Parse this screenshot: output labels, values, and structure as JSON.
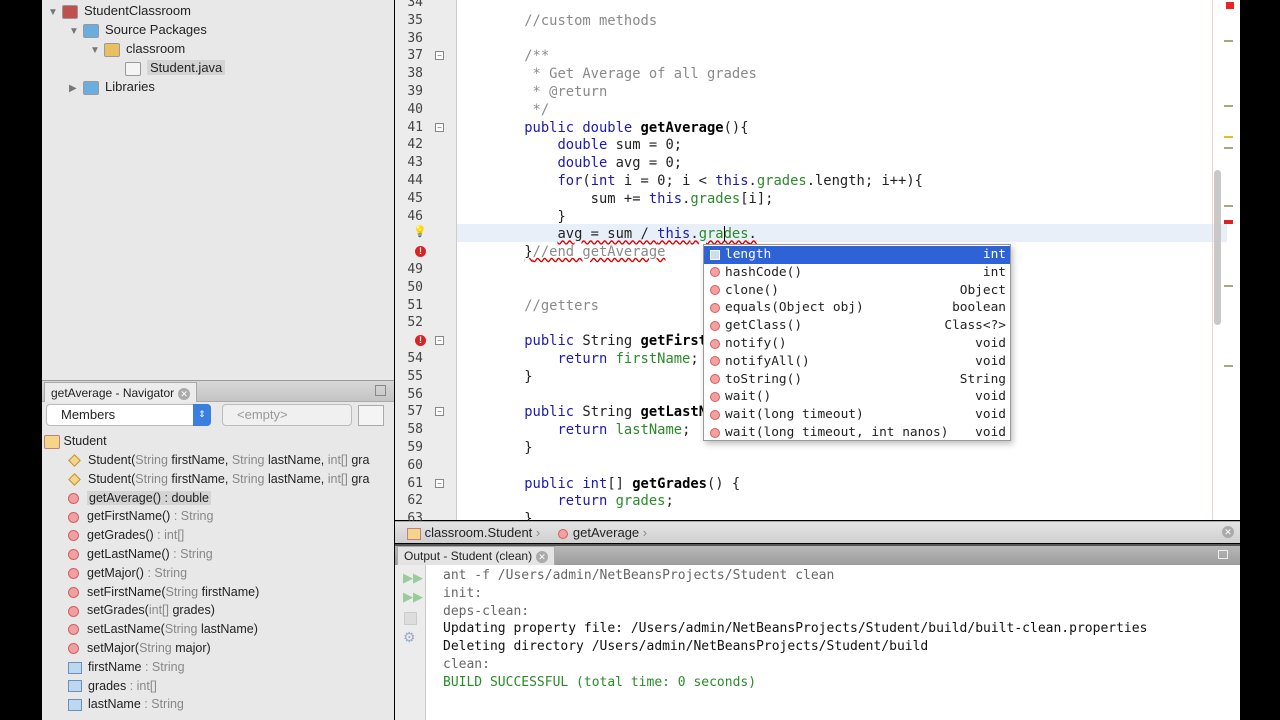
{
  "project": {
    "items": [
      {
        "label": "StudentClassroom",
        "level": 0,
        "expanded": true,
        "icon": "project-icon"
      },
      {
        "label": "Source Packages",
        "level": 1,
        "expanded": true,
        "icon": "source-folder-icon"
      },
      {
        "label": "classroom",
        "level": 2,
        "expanded": true,
        "icon": "package-icon"
      },
      {
        "label": "Student.java",
        "level": 3,
        "selected": true,
        "icon": "java-file-icon"
      },
      {
        "label": "Libraries",
        "level": 1,
        "expanded": false,
        "icon": "libraries-icon"
      }
    ]
  },
  "navigator": {
    "title": "getAverage - Navigator",
    "filter": "Members",
    "filter2": "<empty>",
    "class_name": "Student",
    "members": [
      {
        "kind": "ctor",
        "name": "Student(",
        "sig": [
          [
            "String ",
            "g"
          ],
          [
            "firstName, ",
            ""
          ],
          [
            "String ",
            "g"
          ],
          [
            "lastName, ",
            ""
          ],
          [
            "int[] ",
            "g"
          ],
          [
            "gra",
            ""
          ]
        ]
      },
      {
        "kind": "ctor",
        "name": "Student(",
        "sig": [
          [
            "String ",
            "g"
          ],
          [
            "firstName, ",
            ""
          ],
          [
            "String ",
            "g"
          ],
          [
            "lastName, ",
            ""
          ],
          [
            "int[] ",
            "g"
          ],
          [
            "gra",
            ""
          ]
        ]
      },
      {
        "kind": "method",
        "name": "getAverage() : double",
        "sig": [],
        "selected": true
      },
      {
        "kind": "method",
        "name": "getFirstName()",
        "sig": [
          [
            " : String",
            "g"
          ]
        ]
      },
      {
        "kind": "method",
        "name": "getGrades()",
        "sig": [
          [
            " : int[]",
            "g"
          ]
        ]
      },
      {
        "kind": "method",
        "name": "getLastName()",
        "sig": [
          [
            " : String",
            "g"
          ]
        ]
      },
      {
        "kind": "method",
        "name": "getMajor()",
        "sig": [
          [
            " : String",
            "g"
          ]
        ]
      },
      {
        "kind": "method",
        "name": "setFirstName(",
        "sig": [
          [
            "String ",
            "g"
          ],
          [
            "firstName)",
            ""
          ]
        ]
      },
      {
        "kind": "method",
        "name": "setGrades(",
        "sig": [
          [
            "int[] ",
            "g"
          ],
          [
            "grades)",
            ""
          ]
        ]
      },
      {
        "kind": "method",
        "name": "setLastName(",
        "sig": [
          [
            "String ",
            "g"
          ],
          [
            "lastName)",
            ""
          ]
        ]
      },
      {
        "kind": "method",
        "name": "setMajor(",
        "sig": [
          [
            "String ",
            "g"
          ],
          [
            "major)",
            ""
          ]
        ]
      },
      {
        "kind": "field",
        "name": "firstName",
        "sig": [
          [
            " : String",
            "g"
          ]
        ]
      },
      {
        "kind": "field",
        "name": "grades",
        "sig": [
          [
            " : int[]",
            "g"
          ]
        ]
      },
      {
        "kind": "field",
        "name": "lastName",
        "sig": [
          [
            " : String",
            "g"
          ]
        ]
      }
    ]
  },
  "editor": {
    "lines": [
      {
        "n": "34",
        "t": []
      },
      {
        "n": "35",
        "t": [
          [
            "    //custom methods",
            "cm"
          ]
        ]
      },
      {
        "n": "36",
        "t": []
      },
      {
        "n": "37",
        "t": [
          [
            "    /**",
            "cm"
          ]
        ],
        "fold": true
      },
      {
        "n": "38",
        "t": [
          [
            "     * Get Average of all grades",
            "cm"
          ]
        ]
      },
      {
        "n": "39",
        "t": [
          [
            "     * @return",
            "cm"
          ]
        ]
      },
      {
        "n": "40",
        "t": [
          [
            "     */",
            "cm"
          ]
        ]
      },
      {
        "n": "41",
        "t": [
          [
            "    ",
            ""
          ],
          [
            "public double ",
            "kw"
          ],
          [
            "getAverage",
            "fn"
          ],
          [
            "(){",
            ""
          ]
        ],
        "fold": true
      },
      {
        "n": "42",
        "t": [
          [
            "        ",
            ""
          ],
          [
            "double ",
            "kw"
          ],
          [
            "sum = 0;",
            ""
          ]
        ]
      },
      {
        "n": "43",
        "t": [
          [
            "        ",
            ""
          ],
          [
            "double ",
            "kw"
          ],
          [
            "avg = 0;",
            ""
          ]
        ]
      },
      {
        "n": "44",
        "t": [
          [
            "        ",
            ""
          ],
          [
            "for",
            "kw"
          ],
          [
            "(",
            ""
          ],
          [
            "int ",
            "kw"
          ],
          [
            "i = 0; i < ",
            ""
          ],
          [
            "this",
            "kw"
          ],
          [
            ".",
            ""
          ],
          [
            "grades",
            "fd"
          ],
          [
            ".length; i++){",
            ""
          ]
        ]
      },
      {
        "n": "45",
        "t": [
          [
            "            sum += ",
            ""
          ],
          [
            "this",
            "kw"
          ],
          [
            ".",
            ""
          ],
          [
            "grades",
            "fd"
          ],
          [
            "[i];",
            ""
          ]
        ]
      },
      {
        "n": "46",
        "t": [
          [
            "        }",
            ""
          ]
        ]
      },
      {
        "n": "",
        "t": [
          [
            "        ",
            ""
          ],
          [
            "avg = sum / ",
            "err"
          ],
          [
            "this",
            "kw err"
          ],
          [
            ".",
            "err"
          ],
          [
            "grades",
            "fd err"
          ],
          [
            ".",
            "err"
          ]
        ],
        "icon": "hint"
      },
      {
        "n": "",
        "t": [
          [
            "    ",
            ""
          ],
          [
            "}",
            "err"
          ],
          [
            "//end getAverage",
            "cm err"
          ]
        ],
        "icon": "error"
      },
      {
        "n": "49",
        "t": []
      },
      {
        "n": "50",
        "t": []
      },
      {
        "n": "51",
        "t": [
          [
            "    //getters",
            "cm"
          ]
        ]
      },
      {
        "n": "52",
        "t": []
      },
      {
        "n": "",
        "t": [
          [
            "    ",
            ""
          ],
          [
            "public ",
            "kw"
          ],
          [
            "String ",
            ""
          ],
          [
            "getFirstName",
            "fn"
          ],
          [
            "(){",
            ""
          ]
        ],
        "fold": true,
        "icon": "error"
      },
      {
        "n": "54",
        "t": [
          [
            "        ",
            ""
          ],
          [
            "return ",
            "kw"
          ],
          [
            "firstName",
            "fd"
          ],
          [
            ";",
            ""
          ]
        ]
      },
      {
        "n": "55",
        "t": [
          [
            "    }",
            ""
          ]
        ]
      },
      {
        "n": "56",
        "t": []
      },
      {
        "n": "57",
        "t": [
          [
            "    ",
            ""
          ],
          [
            "public ",
            "kw"
          ],
          [
            "String ",
            ""
          ],
          [
            "getLastName",
            "fn"
          ],
          [
            "(){",
            ""
          ]
        ],
        "fold": true
      },
      {
        "n": "58",
        "t": [
          [
            "        ",
            ""
          ],
          [
            "return ",
            "kw"
          ],
          [
            "lastName",
            "fd"
          ],
          [
            ";",
            ""
          ]
        ]
      },
      {
        "n": "59",
        "t": [
          [
            "    }",
            ""
          ]
        ]
      },
      {
        "n": "60",
        "t": []
      },
      {
        "n": "61",
        "t": [
          [
            "    ",
            ""
          ],
          [
            "public int",
            "kw"
          ],
          [
            "[] ",
            ""
          ],
          [
            "getGrades",
            "fn"
          ],
          [
            "() {",
            ""
          ]
        ],
        "fold": true
      },
      {
        "n": "62",
        "t": [
          [
            "        ",
            ""
          ],
          [
            "return ",
            "kw"
          ],
          [
            "grades",
            "fd"
          ],
          [
            ";",
            ""
          ]
        ]
      },
      {
        "n": "63",
        "t": [
          [
            "    }",
            ""
          ]
        ]
      }
    ]
  },
  "completion": [
    {
      "label": "length",
      "type": "int",
      "kind": "field"
    },
    {
      "label": "hashCode()",
      "type": "int"
    },
    {
      "label": "clone()",
      "type": "Object"
    },
    {
      "label": "equals(Object obj)",
      "type": "boolean"
    },
    {
      "label": "getClass()",
      "type": "Class<?>"
    },
    {
      "label": "notify()",
      "type": "void"
    },
    {
      "label": "notifyAll()",
      "type": "void"
    },
    {
      "label": "toString()",
      "type": "String"
    },
    {
      "label": "wait()",
      "type": "void"
    },
    {
      "label": "wait(long timeout)",
      "type": "void"
    },
    {
      "label": "wait(long timeout, int nanos)",
      "type": "void"
    }
  ],
  "breadcrumb": {
    "cls": "classroom.Student",
    "method": "getAverage"
  },
  "output": {
    "title": "Output - Student (clean)",
    "lines": [
      {
        "text": "ant -f /Users/admin/NetBeansProjects/Student clean",
        "c": "#666"
      },
      {
        "text": "init:",
        "c": "#666"
      },
      {
        "text": "deps-clean:",
        "c": "#666"
      },
      {
        "text": "Updating property file: /Users/admin/NetBeansProjects/Student/build/built-clean.properties",
        "c": "#111"
      },
      {
        "text": "Deleting directory /Users/admin/NetBeansProjects/Student/build",
        "c": "#111"
      },
      {
        "text": "clean:",
        "c": "#666"
      },
      {
        "text": "BUILD SUCCESSFUL (total time: 0 seconds)",
        "c": "#2a8a2a"
      }
    ]
  }
}
